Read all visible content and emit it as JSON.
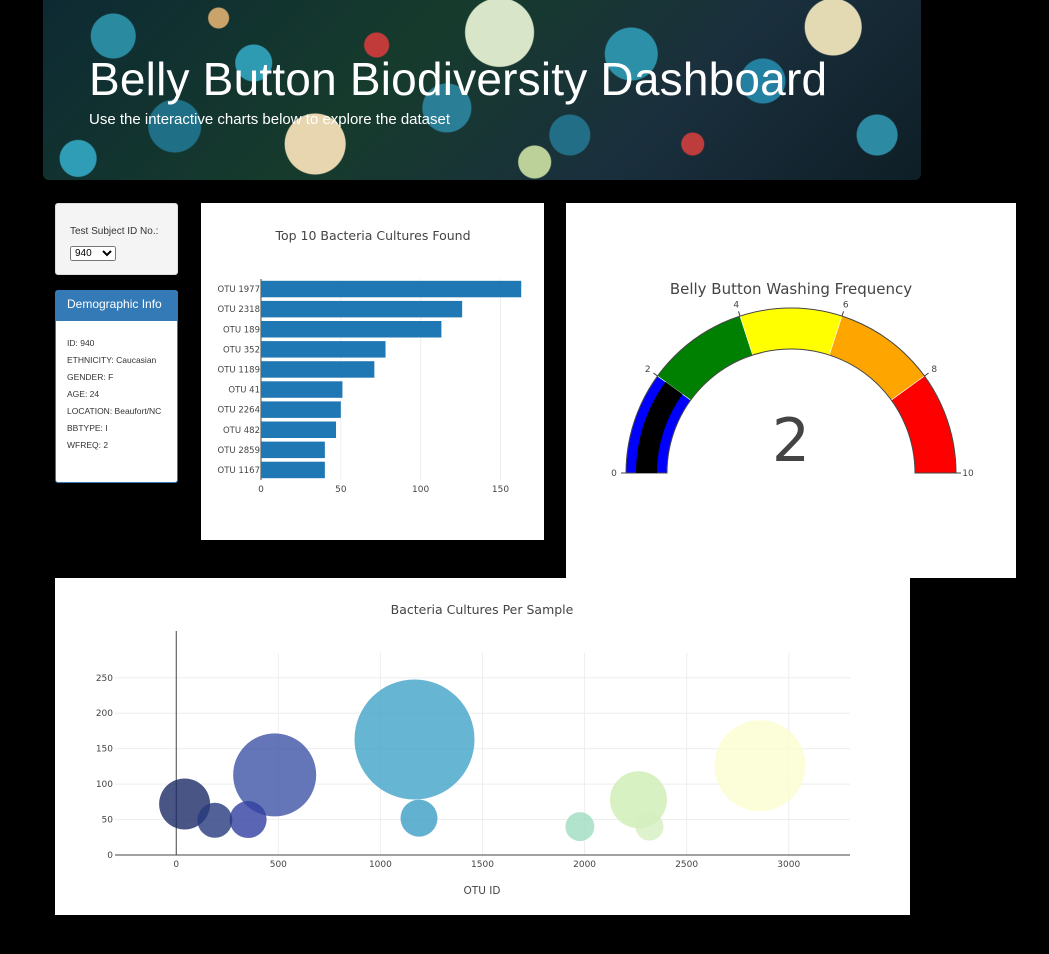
{
  "header": {
    "title": "Belly Button Biodiversity Dashboard",
    "subtitle": "Use the interactive charts below to explore the dataset"
  },
  "selector": {
    "label": "Test Subject ID No.:",
    "selected": "940"
  },
  "demographics": {
    "title": "Demographic Info",
    "lines": [
      "ID: 940",
      "ETHNICITY: Caucasian",
      "GENDER: F",
      "AGE: 24",
      "LOCATION: Beaufort/NC",
      "BBTYPE: I",
      "WFREQ: 2"
    ]
  },
  "colors": {
    "bar": "#1f77b4",
    "panel_header": "#337ab7"
  },
  "chart_data": [
    {
      "type": "bar",
      "orientation": "horizontal",
      "title": "Top 10 Bacteria Cultures Found",
      "categories": [
        "OTU 1977",
        "OTU 2318",
        "OTU 189",
        "OTU 352",
        "OTU 1189",
        "OTU 41",
        "OTU 2264",
        "OTU 482",
        "OTU 2859",
        "OTU 1167"
      ],
      "values": [
        163,
        126,
        113,
        78,
        71,
        51,
        50,
        47,
        40,
        40
      ],
      "xticks": [
        0,
        50,
        100,
        150
      ],
      "xlim": [
        0,
        171
      ]
    },
    {
      "type": "gauge",
      "title": "Belly Button Washing Frequency",
      "value": 2,
      "range": [
        0,
        10
      ],
      "ticks": [
        0,
        2,
        4,
        6,
        8,
        10
      ],
      "steps": [
        {
          "range": [
            0,
            2
          ],
          "color": "#0000ff"
        },
        {
          "range": [
            2,
            4
          ],
          "color": "#008000"
        },
        {
          "range": [
            4,
            6
          ],
          "color": "#ffff00"
        },
        {
          "range": [
            6,
            8
          ],
          "color": "#ffa500"
        },
        {
          "range": [
            8,
            10
          ],
          "color": "#ff0000"
        }
      ],
      "bar_color": "#000000"
    },
    {
      "type": "scatter",
      "subtype": "bubble",
      "title": "Bacteria Cultures Per Sample",
      "xlabel": "OTU ID",
      "xticks": [
        0,
        500,
        1000,
        1500,
        2000,
        2500,
        3000
      ],
      "yticks": [
        0,
        50,
        100,
        150,
        200,
        250
      ],
      "xlim": [
        -300,
        3300
      ],
      "ylim": [
        0,
        285
      ],
      "points": [
        {
          "x": 41,
          "y": 72,
          "size": 51,
          "color": "#1a2b66"
        },
        {
          "x": 189,
          "y": 49,
          "size": 35,
          "color": "#27397d"
        },
        {
          "x": 352,
          "y": 50,
          "size": 37,
          "color": "#3140a0"
        },
        {
          "x": 482,
          "y": 113,
          "size": 83,
          "color": "#3d52a6"
        },
        {
          "x": 1167,
          "y": 163,
          "size": 120,
          "color": "#3fa3c8"
        },
        {
          "x": 1189,
          "y": 52,
          "size": 37,
          "color": "#3c9ec4"
        },
        {
          "x": 1977,
          "y": 40,
          "size": 29,
          "color": "#9fdcbf"
        },
        {
          "x": 2264,
          "y": 78,
          "size": 57,
          "color": "#cdeeb4"
        },
        {
          "x": 2318,
          "y": 40,
          "size": 28,
          "color": "#d5efc0"
        },
        {
          "x": 2859,
          "y": 126,
          "size": 91,
          "color": "#fbfdd0"
        }
      ]
    }
  ]
}
